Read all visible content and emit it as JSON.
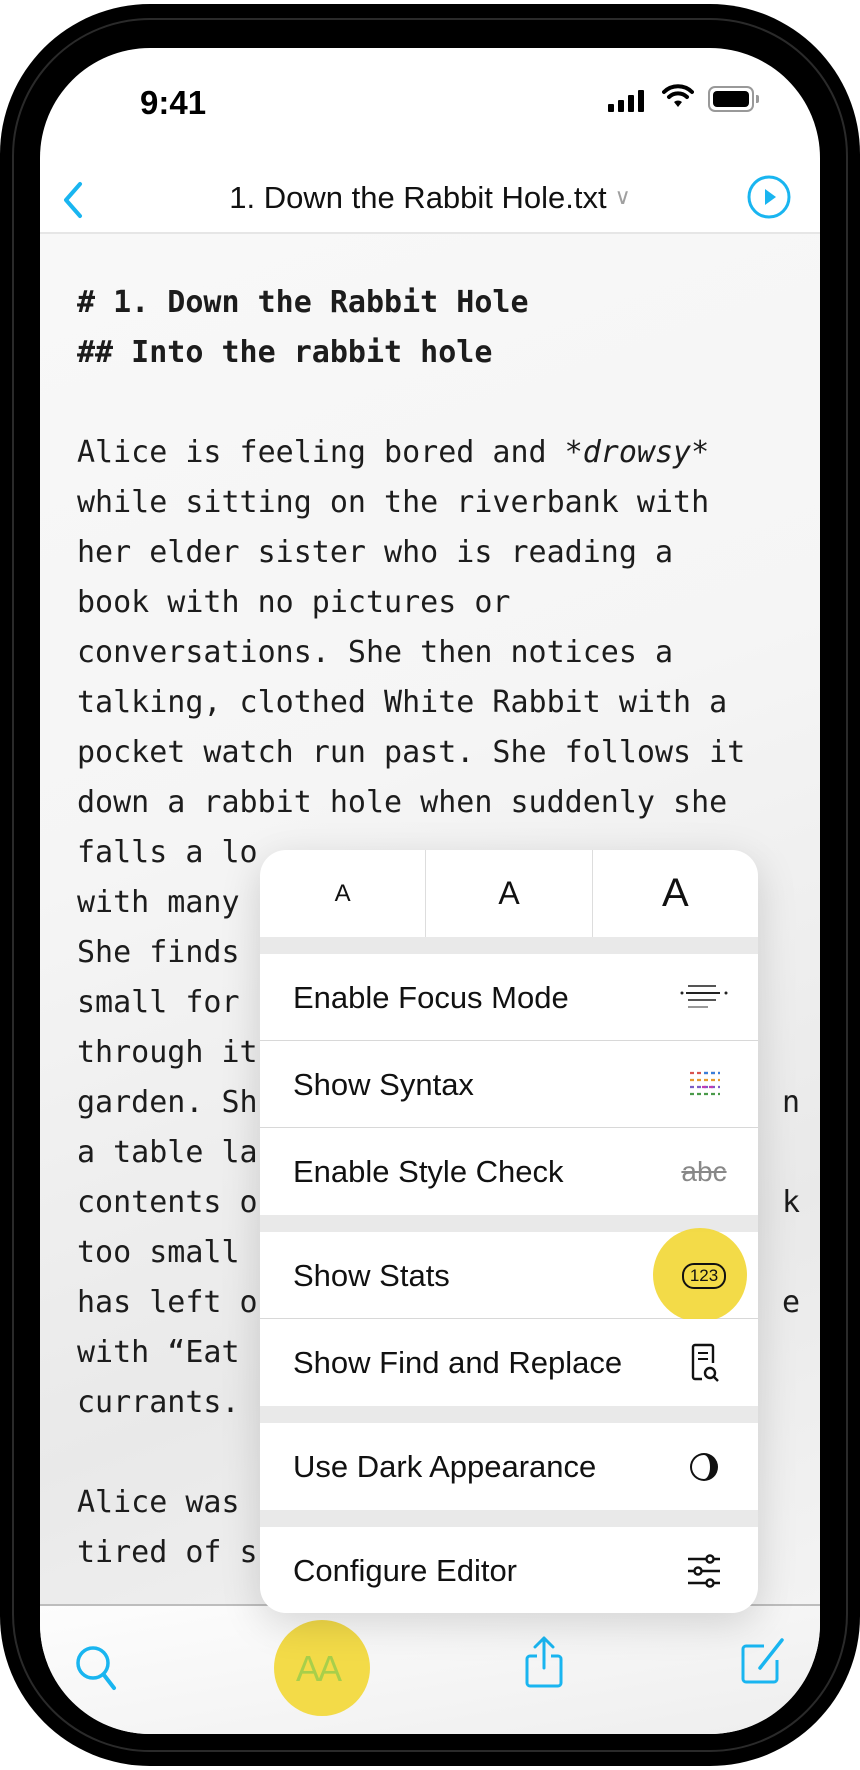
{
  "status_bar": {
    "time": "9:41"
  },
  "nav": {
    "title": "1. Down the Rabbit Hole.txt",
    "dropdown_icon": "chevron-down-icon",
    "back_icon": "chevron-left-icon",
    "play_icon": "play-circle-icon"
  },
  "document": {
    "lines": [
      {
        "text": "# 1. Down the Rabbit Hole",
        "heading": true
      },
      {
        "text": "## Into the rabbit hole",
        "heading": true
      },
      {
        "text": ""
      },
      {
        "text": "Alice is feeling bored and *drowsy*"
      },
      {
        "text": "while sitting on the riverbank with"
      },
      {
        "text": "her elder sister who is reading a"
      },
      {
        "text": "book with no pictures or"
      },
      {
        "text": "conversations. She then notices a"
      },
      {
        "text": "talking, clothed White Rabbit with a"
      },
      {
        "text": "pocket watch run past. She follows it"
      },
      {
        "text": "down a rabbit hole when suddenly she"
      },
      {
        "text": "falls a lo"
      },
      {
        "text": "with many"
      },
      {
        "text": "She finds"
      },
      {
        "text": "small for"
      },
      {
        "text": "through it"
      },
      {
        "text": "garden. Sh",
        "tail": "n"
      },
      {
        "text": "a table la"
      },
      {
        "text": "contents o",
        "tail": "k"
      },
      {
        "text": "too small"
      },
      {
        "text": "has left o",
        "tail": "e"
      },
      {
        "text": "with “Eat"
      },
      {
        "text": "currants."
      },
      {
        "text": ""
      },
      {
        "text": "Alice was"
      },
      {
        "text": "tired of s"
      }
    ]
  },
  "format_menu": {
    "font_sizes": [
      "A",
      "A",
      "A"
    ],
    "items": [
      {
        "label": "Enable Focus Mode",
        "icon": "focus-lines-icon"
      },
      {
        "label": "Show Syntax",
        "icon": "syntax-colors-icon"
      },
      {
        "label": "Enable Style Check",
        "icon": "strikethrough-abc-icon",
        "icon_text": "abc"
      },
      {
        "label": "Show Stats",
        "icon": "number-badge-icon",
        "icon_text": "123",
        "highlighted": true
      },
      {
        "label": "Show Find and Replace",
        "icon": "doc-search-icon"
      },
      {
        "label": "Use Dark Appearance",
        "icon": "contrast-circle-icon"
      },
      {
        "label": "Configure Editor",
        "icon": "sliders-icon"
      }
    ]
  },
  "toolbar": {
    "search_icon": "search-icon",
    "format_label": "AA",
    "share_icon": "share-icon",
    "compose_icon": "compose-icon"
  },
  "colors": {
    "accent": "#19b5f0",
    "highlight": "#f2d83a"
  }
}
